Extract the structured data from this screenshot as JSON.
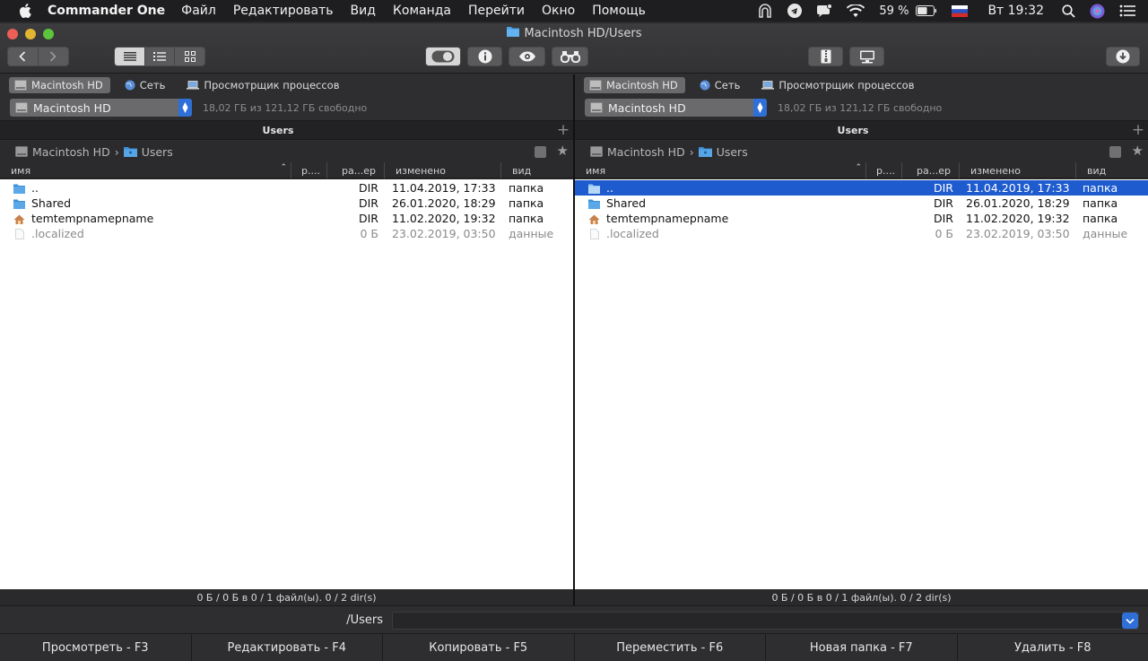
{
  "menubar": {
    "app_name": "Commander One",
    "items": [
      "Файл",
      "Редактировать",
      "Вид",
      "Команда",
      "Перейти",
      "Окно",
      "Помощь"
    ],
    "battery": "59 %",
    "clock": "Вт 19:32"
  },
  "window": {
    "title": "Macintosh HD/Users"
  },
  "panels": {
    "left": {
      "drives": [
        "Macintosh HD",
        "Сеть",
        "Просмотрщик процессов"
      ],
      "selected_drive": "Macintosh HD",
      "free_space": "18,02 ГБ из 121,12 ГБ свободно",
      "tab": "Users",
      "path": [
        "Macintosh HD",
        "Users"
      ],
      "columns": [
        "имя",
        "р....",
        "ра...ер",
        "изменено",
        "вид"
      ],
      "files": [
        {
          "name": "..",
          "size": "DIR",
          "modified": "11.04.2019, 17:33",
          "kind": "папка",
          "icon": "folder-up-icon"
        },
        {
          "name": "Shared",
          "size": "DIR",
          "modified": "26.01.2020, 18:29",
          "kind": "папка",
          "icon": "folder-icon"
        },
        {
          "name": "temtempnamepname",
          "size": "DIR",
          "modified": "11.02.2020, 19:32",
          "kind": "папка",
          "icon": "home-folder-icon"
        },
        {
          "name": ".localized",
          "size": "0 Б",
          "modified": "23.02.2019, 03:50",
          "kind": "данные",
          "icon": "file-icon"
        }
      ],
      "status": "0 Б / 0 Б в 0 / 1 файл(ы). 0 / 2 dir(s)"
    },
    "right": {
      "drives": [
        "Macintosh HD",
        "Сеть",
        "Просмотрщик процессов"
      ],
      "selected_drive": "Macintosh HD",
      "free_space": "18,02 ГБ из 121,12 ГБ свободно",
      "tab": "Users",
      "path": [
        "Macintosh HD",
        "Users"
      ],
      "columns": [
        "имя",
        "р....",
        "ра...ер",
        "изменено",
        "вид"
      ],
      "files": [
        {
          "name": "..",
          "size": "DIR",
          "modified": "11.04.2019, 17:33",
          "kind": "папка",
          "icon": "folder-up-icon"
        },
        {
          "name": "Shared",
          "size": "DIR",
          "modified": "26.01.2020, 18:29",
          "kind": "папка",
          "icon": "folder-icon"
        },
        {
          "name": "temtempnamepname",
          "size": "DIR",
          "modified": "11.02.2020, 19:32",
          "kind": "папка",
          "icon": "home-folder-icon"
        },
        {
          "name": ".localized",
          "size": "0 Б",
          "modified": "23.02.2019, 03:50",
          "kind": "данные",
          "icon": "file-icon"
        }
      ],
      "status": "0 Б / 0 Б в 0 / 1 файл(ы). 0 / 2 dir(s)"
    }
  },
  "command_line": {
    "prompt": "/Users",
    "value": ""
  },
  "function_keys": [
    "Просмотреть - F3",
    "Редактировать - F4",
    "Копировать - F5",
    "Переместить - F6",
    "Новая папка - F7",
    "Удалить - F8"
  ],
  "colors": {
    "selection": "#1e5bce",
    "accent": "#2f6fd8",
    "folder": "#3d8fd6"
  }
}
